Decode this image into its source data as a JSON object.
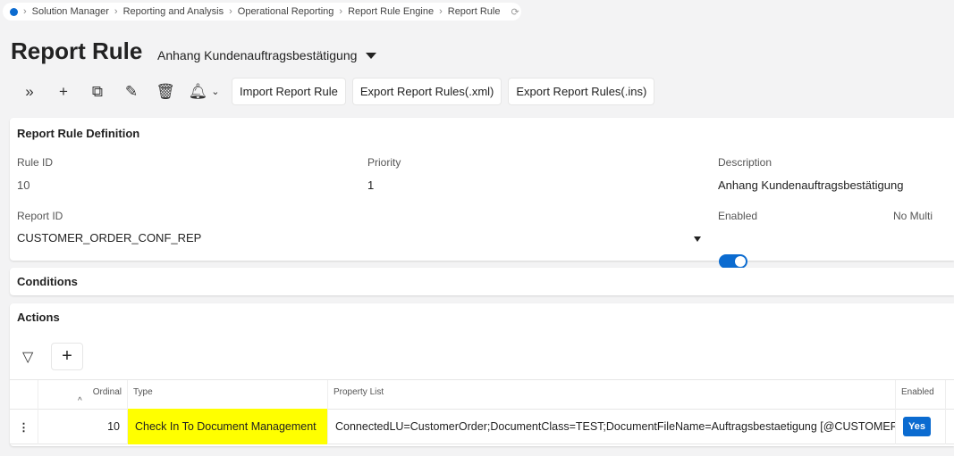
{
  "breadcrumb": [
    "Solution Manager",
    "Reporting and Analysis",
    "Operational Reporting",
    "Report Rule Engine",
    "Report Rule"
  ],
  "page": {
    "title": "Report Rule",
    "subtitle": "Anhang Kundenauftragsbestätigung"
  },
  "toolbar": {
    "import": "Import Report Rule",
    "export_xml": "Export Report Rules(.xml)",
    "export_ins": "Export Report Rules(.ins)"
  },
  "definition": {
    "header": "Report Rule Definition",
    "rule_id_label": "Rule ID",
    "rule_id": "10",
    "priority_label": "Priority",
    "priority": "1",
    "description_label": "Description",
    "description": "Anhang Kundenauftragsbestätigung",
    "report_id_label": "Report ID",
    "report_id": "CUSTOMER_ORDER_CONF_REP",
    "enabled_label": "Enabled",
    "enabled": true,
    "no_multi_label": "No Multi",
    "no_multi": true
  },
  "conditions": {
    "header": "Conditions"
  },
  "actions": {
    "header": "Actions",
    "columns": [
      "Ordinal",
      "Type",
      "Property List",
      "Enabled"
    ],
    "rows": [
      {
        "ordinal": "10",
        "type": "Check In To Document Management",
        "property_list": "ConnectedLU=CustomerOrder;DocumentClass=TEST;DocumentFileName=Auftragsbestaetigung [@CUSTOMER",
        "enabled": "Yes"
      }
    ]
  },
  "colors": {
    "accent": "#0b6bd0",
    "highlight": "#ffff00"
  }
}
